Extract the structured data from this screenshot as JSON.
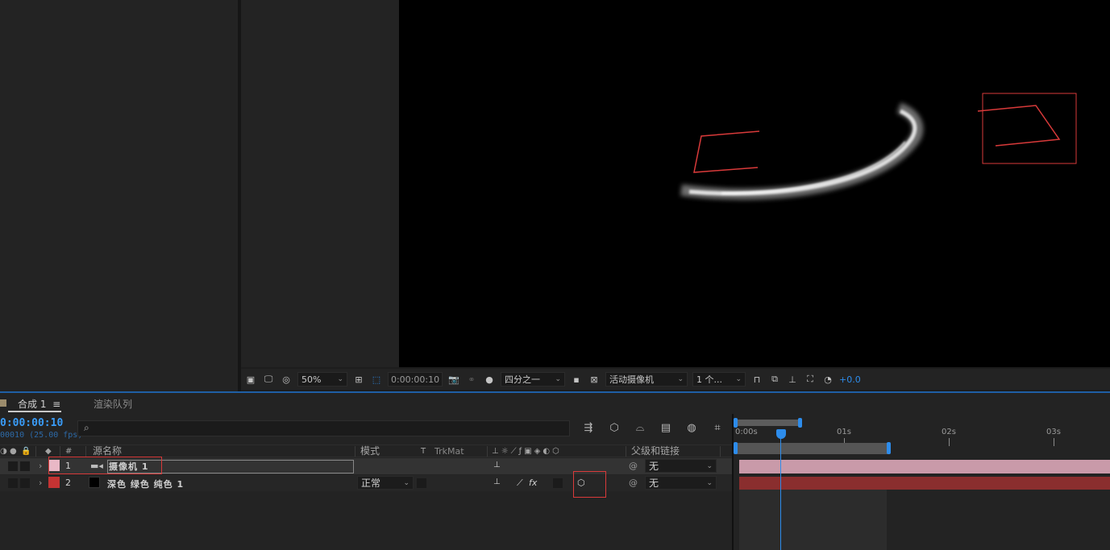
{
  "viewer_toolbar": {
    "zoom": "50%",
    "timecode": "0:00:00:10",
    "resolution": "四分之一",
    "view": "活动摄像机",
    "views_count": "1 个...",
    "exposure": "+0.0"
  },
  "tabs": {
    "comp": "合成 1",
    "comp_menu": "≡",
    "render_queue": "渲染队列"
  },
  "timeline": {
    "timecode": "0:00:00:10",
    "fps": "00010 (25.00 fps)",
    "columns": {
      "number": "#",
      "source_name": "源名称",
      "mode": "模式",
      "t": "T",
      "trkmat": "TrkMat",
      "parent": "父级和链接"
    },
    "layers": [
      {
        "number": "1",
        "name": "摄像机 1",
        "parent": "无",
        "label_color": "#e9b8c6"
      },
      {
        "number": "2",
        "name": "深色 绿色 纯色 1",
        "mode": "正常",
        "parent": "无",
        "label_color": "#c43333"
      }
    ],
    "ruler": [
      "0:00s",
      "01s",
      "02s",
      "03s"
    ]
  },
  "colors": {
    "accent": "#2d8ceb",
    "highlight_box": "#d93a3a",
    "camera_bar": "#c99aa9",
    "solid_bar": "#8a2e2e"
  }
}
